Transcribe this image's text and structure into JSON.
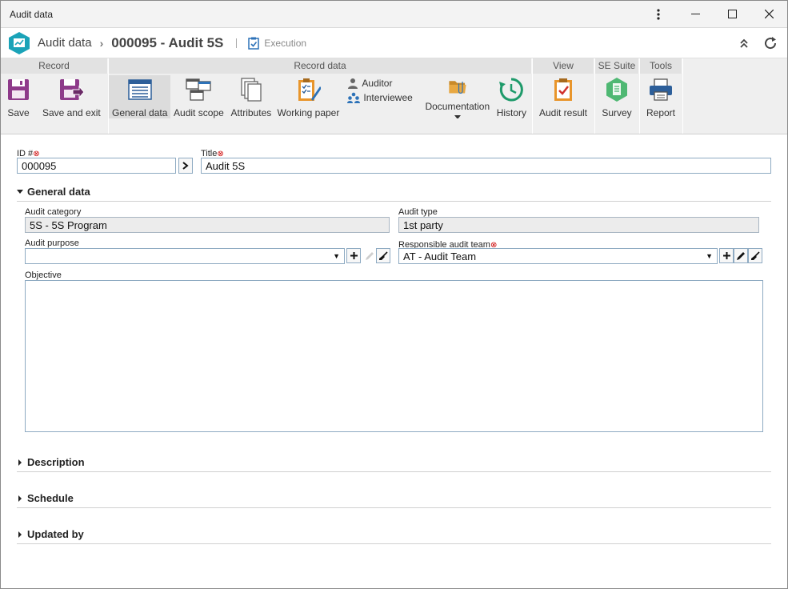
{
  "window": {
    "title": "Audit data"
  },
  "header": {
    "app_name": "Audit data",
    "record_title": "000095 - Audit 5S",
    "status": "Execution"
  },
  "ribbon": {
    "groups": {
      "record": "Record",
      "record_data": "Record data",
      "view": "View",
      "se_suite": "SE Suite",
      "tools": "Tools"
    },
    "buttons": {
      "save": "Save",
      "save_exit": "Save and exit",
      "general_data": "General data",
      "audit_scope": "Audit scope",
      "attributes": "Attributes",
      "working_paper": "Working paper",
      "auditor": "Auditor",
      "interviewee": "Interviewee",
      "documentation": "Documentation",
      "history": "History",
      "audit_result": "Audit result",
      "survey": "Survey",
      "report": "Report"
    }
  },
  "form": {
    "id_label": "ID #",
    "id_value": "000095",
    "title_label": "Title",
    "title_value": "Audit 5S",
    "general_section": "General data",
    "audit_category_label": "Audit category",
    "audit_category_value": "5S - 5S Program",
    "audit_type_label": "Audit type",
    "audit_type_value": "1st party",
    "audit_purpose_label": "Audit purpose",
    "audit_purpose_value": "",
    "resp_team_label": "Responsible audit team",
    "resp_team_value": "AT - Audit Team",
    "objective_label": "Objective",
    "objective_value": ""
  },
  "sections": {
    "description": "Description",
    "schedule": "Schedule",
    "updated_by": "Updated by"
  },
  "colors": {
    "accent_teal": "#1aa3b8",
    "required_red": "#cc0000",
    "field_border": "#8eaac2"
  }
}
